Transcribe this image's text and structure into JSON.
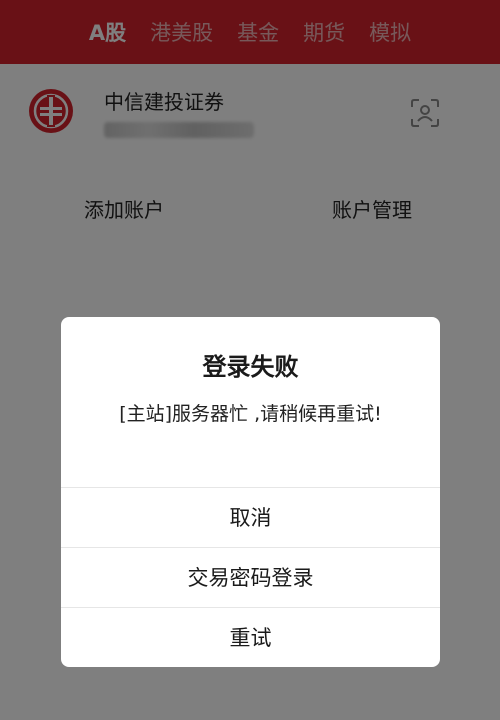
{
  "market_tabs": [
    {
      "label": "A股",
      "active": true
    },
    {
      "label": "港美股",
      "active": false
    },
    {
      "label": "基金",
      "active": false
    },
    {
      "label": "期货",
      "active": false
    },
    {
      "label": "模拟",
      "active": false
    }
  ],
  "broker": {
    "name": "中信建投证券",
    "logo_icon": "citic-logo-icon",
    "user_icon": "user-portrait-icon"
  },
  "actions": {
    "add_account": "添加账户",
    "manage_account": "账户管理"
  },
  "dialog": {
    "title": "登录失败",
    "message": "[主站]服务器忙 ,请稍候再重试!",
    "cancel": "取消",
    "password_login": "交易密码登录",
    "retry": "重试"
  },
  "colors": {
    "brand_red": "#d2222c",
    "overlay": "rgba(0,0,0,0.5)",
    "dialog_bg": "#ffffff"
  }
}
